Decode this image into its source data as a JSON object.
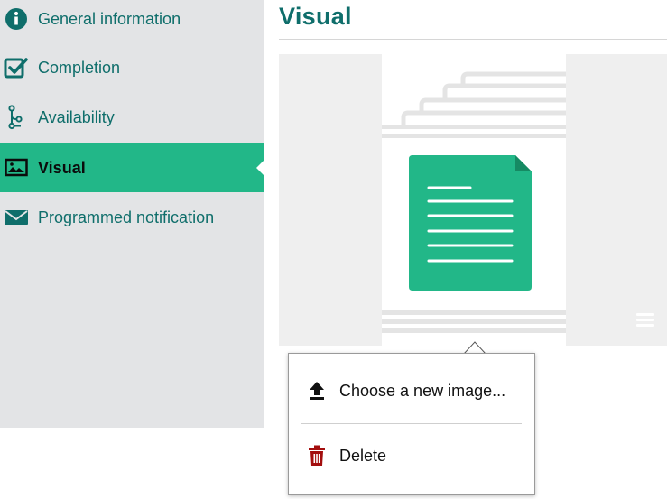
{
  "sidebar": {
    "items": [
      {
        "label": "General information",
        "icon": "info-circle-icon"
      },
      {
        "label": "Completion",
        "icon": "checkbox-icon"
      },
      {
        "label": "Availability",
        "icon": "branch-icon"
      },
      {
        "label": "Visual",
        "icon": "image-icon",
        "active": true
      },
      {
        "label": "Programmed notification",
        "icon": "envelope-icon"
      }
    ]
  },
  "main": {
    "title": "Visual",
    "preview": {
      "icon": "document-icon",
      "menu_icon": "hamburger-icon"
    }
  },
  "popup": {
    "items": [
      {
        "label": "Choose a new image...",
        "icon": "upload-icon"
      },
      {
        "label": "Delete",
        "icon": "trash-icon"
      }
    ]
  },
  "colors": {
    "accent": "#22b788",
    "brand_text": "#0f6e6b",
    "sidebar_bg": "#e3e4e6",
    "delete_red": "#a30e0e"
  }
}
